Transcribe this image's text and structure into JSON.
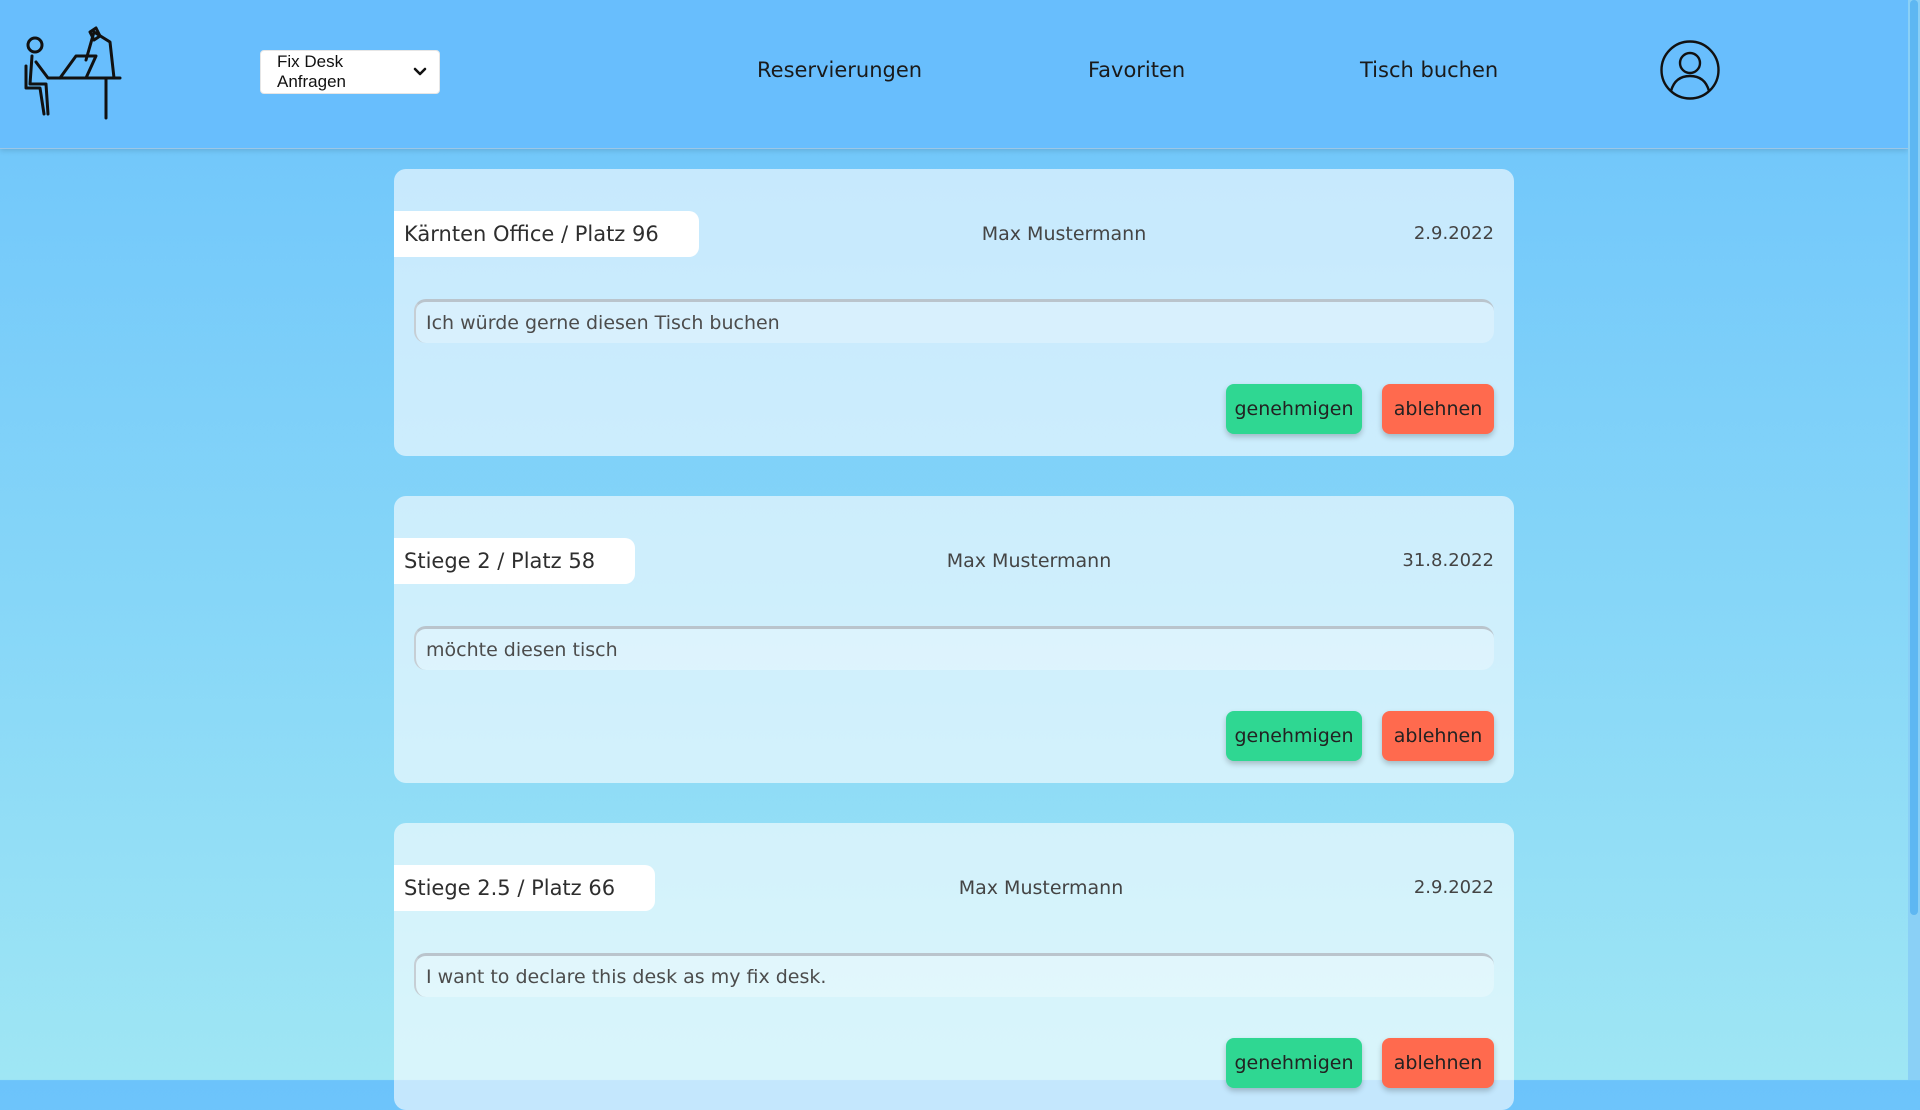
{
  "header": {
    "logo_icon": "person-at-desk-icon",
    "select": {
      "value": "Fix Desk Anfragen"
    },
    "nav": {
      "reservations": "Reservierungen",
      "favorites": "Favoriten",
      "book_table": "Tisch buchen"
    },
    "profile_icon": "user-profile-icon"
  },
  "requests": [
    {
      "place": "Kärnten Office  /  Platz 96",
      "person": "Max Mustermann",
      "date": "2.9.2022",
      "message": "Ich würde gerne diesen Tisch buchen",
      "approve_label": "genehmigen",
      "reject_label": "ablehnen"
    },
    {
      "place": "Stiege 2  /  Platz 58",
      "person": "Max Mustermann",
      "date": "31.8.2022",
      "message": "möchte diesen tisch",
      "approve_label": "genehmigen",
      "reject_label": "ablehnen"
    },
    {
      "place": "Stiege 2.5  /  Platz 66",
      "person": "Max Mustermann",
      "date": "2.9.2022",
      "message": "I want to declare this desk as my fix desk.",
      "approve_label": "genehmigen",
      "reject_label": "ablehnen"
    }
  ],
  "colors": {
    "header_bg": "#68befd",
    "approve": "#2fd792",
    "reject": "#ff6a4e"
  }
}
